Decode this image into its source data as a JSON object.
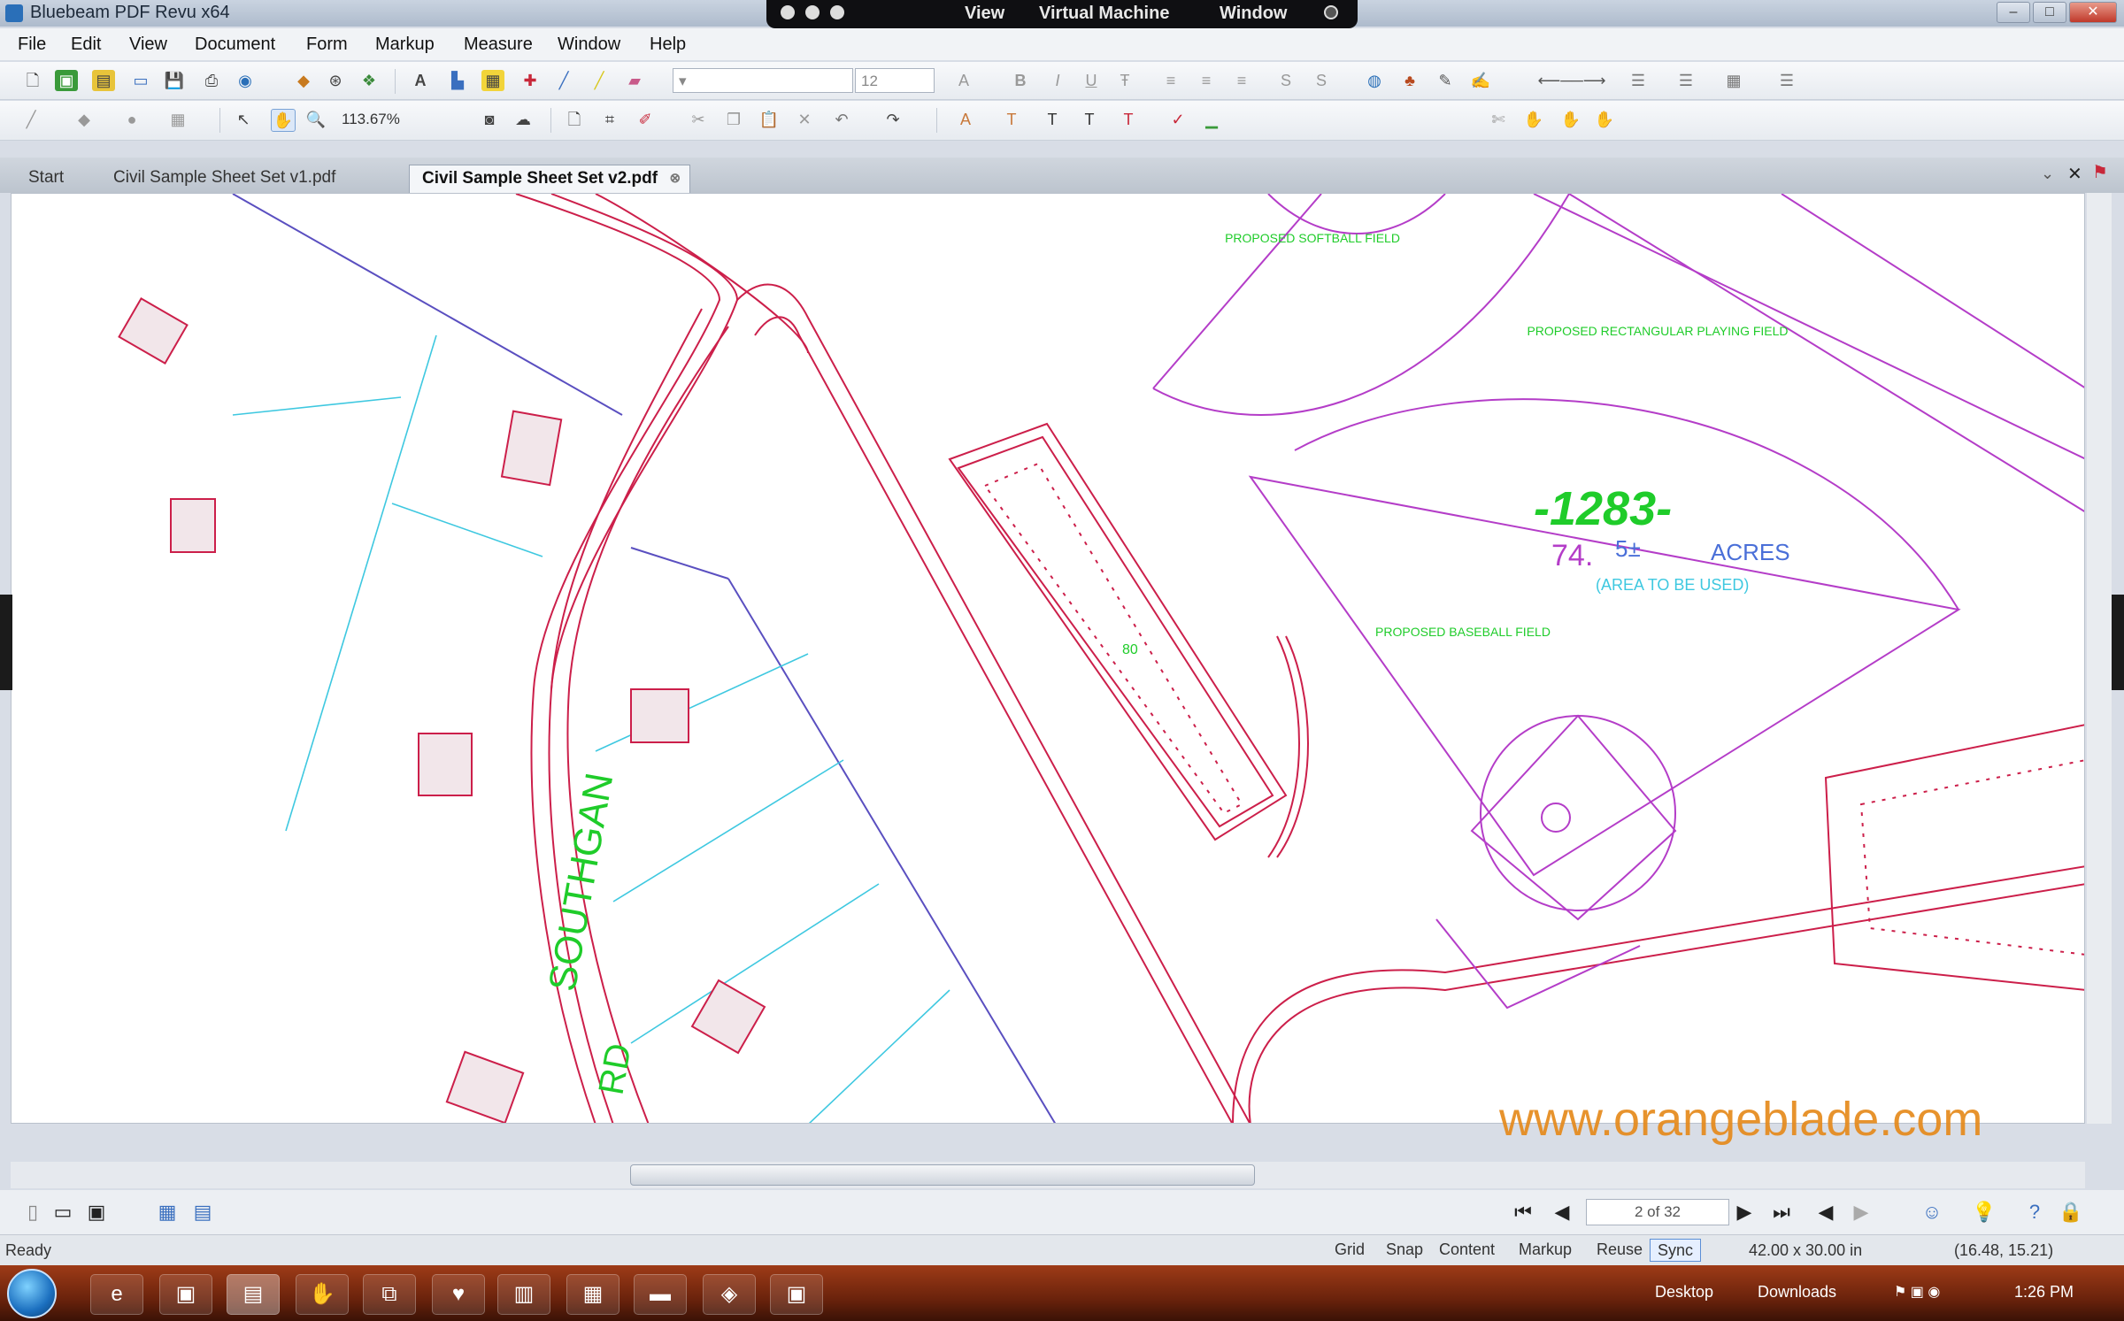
{
  "window": {
    "title": "Bluebeam PDF Revu x64"
  },
  "vm_bar": {
    "items": [
      "View",
      "Virtual Machine",
      "Window"
    ]
  },
  "menu": [
    "File",
    "Edit",
    "View",
    "Document",
    "Form",
    "Markup",
    "Measure",
    "Window",
    "Help"
  ],
  "toolbar": {
    "font_size": "12",
    "zoom": "113.67%"
  },
  "tabs": [
    {
      "label": "Start"
    },
    {
      "label": "Civil Sample Sheet Set v1.pdf"
    },
    {
      "label": "Civil Sample Sheet Set v2.pdf"
    }
  ],
  "drawing": {
    "road_label": "SOUTHGAN",
    "road_label2": "RD",
    "softball_label": "PROPOSED SOFTBALL FIELD",
    "rect_field_label": "PROPOSED RECTANGULAR PLAYING FIELD",
    "baseball_label": "PROPOSED BASEBALL FIELD",
    "lot_number": "-1283-",
    "acres_value": "74.",
    "acres_fraction": "5±",
    "acres_unit": "ACRES",
    "area_note": "(AREA TO BE USED)",
    "parking_count": "80"
  },
  "watermark": "www.orangeblade.com",
  "navigation": {
    "page": "2 of 32"
  },
  "status": {
    "ready": "Ready",
    "buttons": [
      "Grid",
      "Snap",
      "Content",
      "Markup",
      "Reuse",
      "Sync"
    ],
    "active": "Sync",
    "page_size": "42.00 x 30.00 in",
    "coords": "(16.48, 15.21)"
  },
  "taskbar": {
    "desktop": "Desktop",
    "downloads": "Downloads",
    "time": "1:26 PM"
  },
  "colors": {
    "road": "#cc1f4a",
    "field": "#b43dc8",
    "label": "#1fcc2a",
    "water": "#3ec8e0",
    "property": "#5a4fc0",
    "watermark": "#e68a1c"
  }
}
